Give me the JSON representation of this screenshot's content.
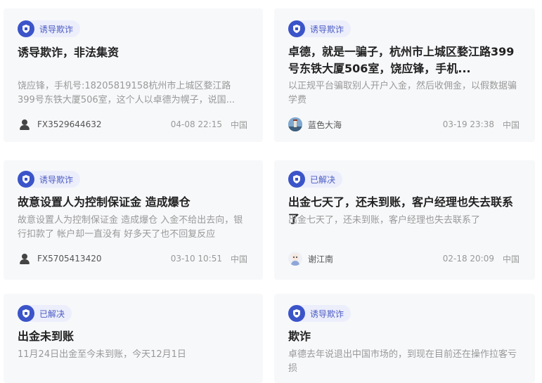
{
  "cards": [
    {
      "tag": "诱导欺诈",
      "title": "诱导欺诈，非法集资",
      "desc": "饶应锋，手机号:18205819158杭州市上城区婺江路399号东铁大厦506室，这个人以卓德为幌子，说国...",
      "user": "FX3529644632",
      "time": "04-08 22:15",
      "region": "中国",
      "avatar": "person-icon"
    },
    {
      "tag": "诱导欺诈",
      "title": "卓德，就是一骗子，杭州市上城区婺江路399号东铁大厦506室，饶应锋，手机...",
      "desc": "以正规平台骗取别人开户入金，然后收佣金，以假数据骗学费",
      "user": "蓝色大海",
      "time": "03-19 23:38",
      "region": "中国",
      "avatar": "lighthouse-photo"
    },
    {
      "tag": "诱导欺诈",
      "title": "故意设置人为控制保证金 造成爆仓",
      "desc": "故意设置人为控制保证金 造成爆仓 入金不给出去向，银行扣款了 帐户却一直没有 好多天了也不回复反应",
      "user": "FX5705413420",
      "time": "03-10 10:51",
      "region": "中国",
      "avatar": "person-icon"
    },
    {
      "tag": "已解决",
      "title": "出金七天了，还未到账，客户经理也失去联系了",
      "desc": "出金七天了，还未到账，客户经理也失去联系了",
      "user": "谢江南",
      "time": "02-18 20:09",
      "region": "中国",
      "avatar": "cartoon-avatar"
    },
    {
      "tag": "已解决",
      "title": "出金未到账",
      "desc": "11月24日出金至今未到账，今天12月1日",
      "avatar": "none"
    },
    {
      "tag": "诱导欺诈",
      "title": "欺诈",
      "desc": "卓德去年说退出中国市场的，到现在目前还在操作拉客亏损",
      "avatar": "none"
    }
  ]
}
